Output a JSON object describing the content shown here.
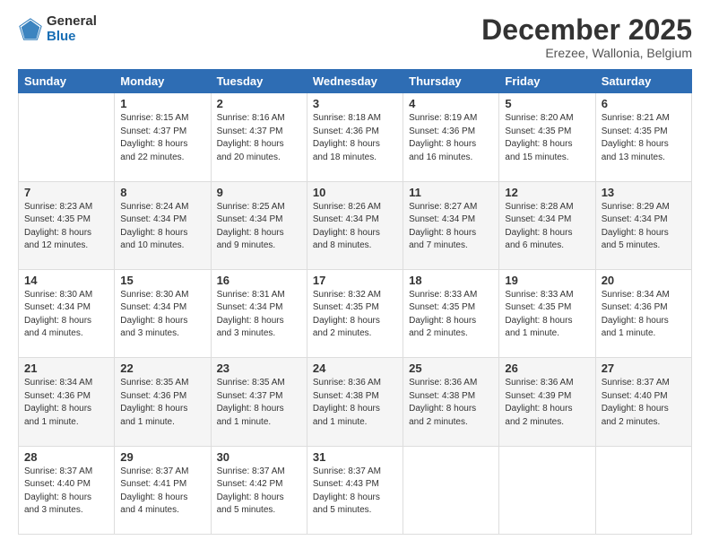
{
  "logo": {
    "general": "General",
    "blue": "Blue"
  },
  "header": {
    "month": "December 2025",
    "location": "Erezee, Wallonia, Belgium"
  },
  "days_of_week": [
    "Sunday",
    "Monday",
    "Tuesday",
    "Wednesday",
    "Thursday",
    "Friday",
    "Saturday"
  ],
  "weeks": [
    [
      {
        "day": "",
        "info": ""
      },
      {
        "day": "1",
        "info": "Sunrise: 8:15 AM\nSunset: 4:37 PM\nDaylight: 8 hours\nand 22 minutes."
      },
      {
        "day": "2",
        "info": "Sunrise: 8:16 AM\nSunset: 4:37 PM\nDaylight: 8 hours\nand 20 minutes."
      },
      {
        "day": "3",
        "info": "Sunrise: 8:18 AM\nSunset: 4:36 PM\nDaylight: 8 hours\nand 18 minutes."
      },
      {
        "day": "4",
        "info": "Sunrise: 8:19 AM\nSunset: 4:36 PM\nDaylight: 8 hours\nand 16 minutes."
      },
      {
        "day": "5",
        "info": "Sunrise: 8:20 AM\nSunset: 4:35 PM\nDaylight: 8 hours\nand 15 minutes."
      },
      {
        "day": "6",
        "info": "Sunrise: 8:21 AM\nSunset: 4:35 PM\nDaylight: 8 hours\nand 13 minutes."
      }
    ],
    [
      {
        "day": "7",
        "info": "Sunrise: 8:23 AM\nSunset: 4:35 PM\nDaylight: 8 hours\nand 12 minutes."
      },
      {
        "day": "8",
        "info": "Sunrise: 8:24 AM\nSunset: 4:34 PM\nDaylight: 8 hours\nand 10 minutes."
      },
      {
        "day": "9",
        "info": "Sunrise: 8:25 AM\nSunset: 4:34 PM\nDaylight: 8 hours\nand 9 minutes."
      },
      {
        "day": "10",
        "info": "Sunrise: 8:26 AM\nSunset: 4:34 PM\nDaylight: 8 hours\nand 8 minutes."
      },
      {
        "day": "11",
        "info": "Sunrise: 8:27 AM\nSunset: 4:34 PM\nDaylight: 8 hours\nand 7 minutes."
      },
      {
        "day": "12",
        "info": "Sunrise: 8:28 AM\nSunset: 4:34 PM\nDaylight: 8 hours\nand 6 minutes."
      },
      {
        "day": "13",
        "info": "Sunrise: 8:29 AM\nSunset: 4:34 PM\nDaylight: 8 hours\nand 5 minutes."
      }
    ],
    [
      {
        "day": "14",
        "info": "Sunrise: 8:30 AM\nSunset: 4:34 PM\nDaylight: 8 hours\nand 4 minutes."
      },
      {
        "day": "15",
        "info": "Sunrise: 8:30 AM\nSunset: 4:34 PM\nDaylight: 8 hours\nand 3 minutes."
      },
      {
        "day": "16",
        "info": "Sunrise: 8:31 AM\nSunset: 4:34 PM\nDaylight: 8 hours\nand 3 minutes."
      },
      {
        "day": "17",
        "info": "Sunrise: 8:32 AM\nSunset: 4:35 PM\nDaylight: 8 hours\nand 2 minutes."
      },
      {
        "day": "18",
        "info": "Sunrise: 8:33 AM\nSunset: 4:35 PM\nDaylight: 8 hours\nand 2 minutes."
      },
      {
        "day": "19",
        "info": "Sunrise: 8:33 AM\nSunset: 4:35 PM\nDaylight: 8 hours\nand 1 minute."
      },
      {
        "day": "20",
        "info": "Sunrise: 8:34 AM\nSunset: 4:36 PM\nDaylight: 8 hours\nand 1 minute."
      }
    ],
    [
      {
        "day": "21",
        "info": "Sunrise: 8:34 AM\nSunset: 4:36 PM\nDaylight: 8 hours\nand 1 minute."
      },
      {
        "day": "22",
        "info": "Sunrise: 8:35 AM\nSunset: 4:36 PM\nDaylight: 8 hours\nand 1 minute."
      },
      {
        "day": "23",
        "info": "Sunrise: 8:35 AM\nSunset: 4:37 PM\nDaylight: 8 hours\nand 1 minute."
      },
      {
        "day": "24",
        "info": "Sunrise: 8:36 AM\nSunset: 4:38 PM\nDaylight: 8 hours\nand 1 minute."
      },
      {
        "day": "25",
        "info": "Sunrise: 8:36 AM\nSunset: 4:38 PM\nDaylight: 8 hours\nand 2 minutes."
      },
      {
        "day": "26",
        "info": "Sunrise: 8:36 AM\nSunset: 4:39 PM\nDaylight: 8 hours\nand 2 minutes."
      },
      {
        "day": "27",
        "info": "Sunrise: 8:37 AM\nSunset: 4:40 PM\nDaylight: 8 hours\nand 2 minutes."
      }
    ],
    [
      {
        "day": "28",
        "info": "Sunrise: 8:37 AM\nSunset: 4:40 PM\nDaylight: 8 hours\nand 3 minutes."
      },
      {
        "day": "29",
        "info": "Sunrise: 8:37 AM\nSunset: 4:41 PM\nDaylight: 8 hours\nand 4 minutes."
      },
      {
        "day": "30",
        "info": "Sunrise: 8:37 AM\nSunset: 4:42 PM\nDaylight: 8 hours\nand 5 minutes."
      },
      {
        "day": "31",
        "info": "Sunrise: 8:37 AM\nSunset: 4:43 PM\nDaylight: 8 hours\nand 5 minutes."
      },
      {
        "day": "",
        "info": ""
      },
      {
        "day": "",
        "info": ""
      },
      {
        "day": "",
        "info": ""
      }
    ]
  ]
}
